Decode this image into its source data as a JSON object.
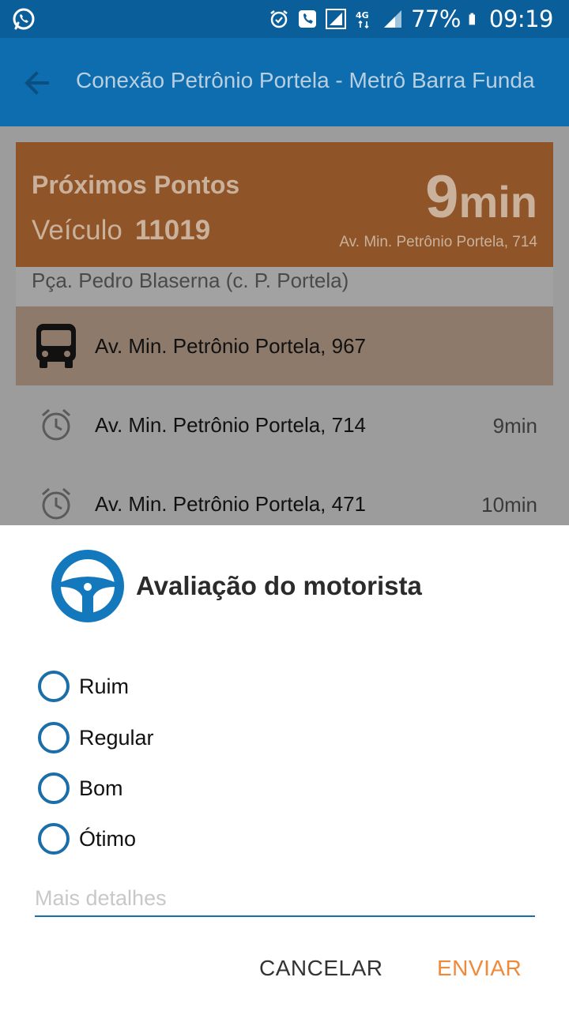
{
  "status_bar": {
    "icons": [
      "whatsapp-icon",
      "alarm-icon",
      "phone-icon",
      "signal-icon",
      "4g-icon",
      "signal-bars-icon",
      "battery-icon"
    ],
    "battery": "77%",
    "time": "09:19"
  },
  "app_bar": {
    "title": "Conexão Petrônio Portela - Metrô Barra Funda"
  },
  "card": {
    "heading": "Próximos Pontos",
    "vehicle_label": "Veículo",
    "vehicle_number": "11019",
    "eta_value": "9",
    "eta_unit": "min",
    "eta_address": "Av. Min. Petrônio Portela, 714"
  },
  "stops": [
    {
      "name": "Pça. Pedro Blaserna (c. P. Portela)",
      "time": ""
    },
    {
      "name": "Av. Min. Petrônio Portela, 967",
      "time": "",
      "icon": "bus-icon"
    },
    {
      "name": "Av. Min. Petrônio Portela, 714",
      "time": "9min",
      "icon": "alarm-icon"
    },
    {
      "name": "Av. Min. Petrônio Portela, 471",
      "time": "10min",
      "icon": "alarm-icon"
    }
  ],
  "dialog": {
    "icon": "steering-wheel-icon",
    "title": "Avaliação do motorista",
    "options": [
      "Ruim",
      "Regular",
      "Bom",
      "Ótimo"
    ],
    "details_placeholder": "Mais detalhes",
    "details_value": "",
    "cancel_label": "CANCELAR",
    "send_label": "ENVIAR"
  },
  "colors": {
    "status_bar": "#0a5f9a",
    "app_bar": "#0d6daf",
    "accent_blue": "#1b6ea8",
    "accent_orange": "#ef8a3a",
    "card_orange_dimmed": "#8f5428"
  }
}
